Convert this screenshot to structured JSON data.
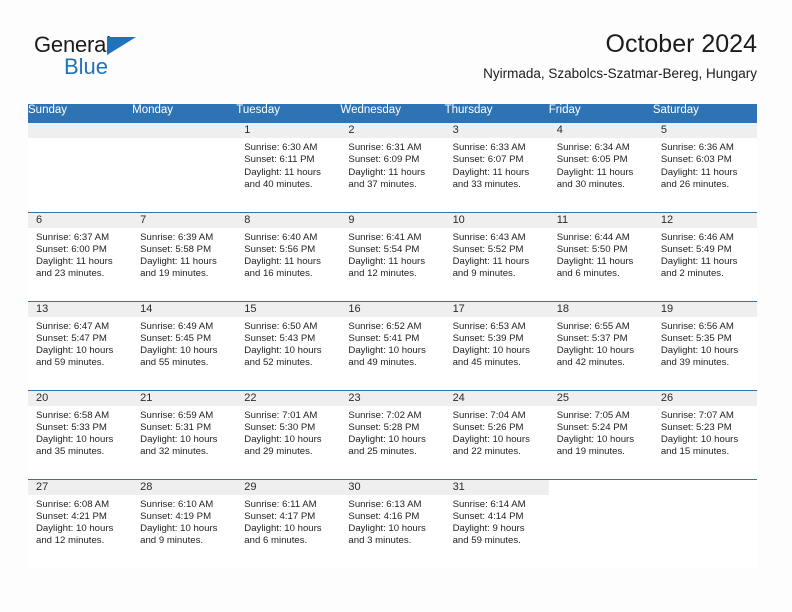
{
  "logo": {
    "word_one": "General",
    "word_two": "Blue",
    "triangle_color": "#1f72bb",
    "text_color": "#1b1b1b"
  },
  "header": {
    "title": "October 2024",
    "location": "Nyirmada, Szabolcs-Szatmar-Bereg, Hungary"
  },
  "theme": {
    "header_blue": "#2e74b5",
    "daynum_band": "#efefef",
    "page_bg": "#fdfdfd",
    "text": "#1f1f1f"
  },
  "calendar": {
    "weekday_headers": [
      "Sunday",
      "Monday",
      "Tuesday",
      "Wednesday",
      "Thursday",
      "Friday",
      "Saturday"
    ],
    "labels": {
      "sunrise": "Sunrise:",
      "sunset": "Sunset:",
      "daylight": "Daylight:"
    },
    "weeks": [
      [
        {
          "day": "",
          "sunrise": "",
          "sunset": "",
          "daylight_a": "",
          "daylight_b": ""
        },
        {
          "day": "",
          "sunrise": "",
          "sunset": "",
          "daylight_a": "",
          "daylight_b": ""
        },
        {
          "day": "1",
          "sunrise": "Sunrise: 6:30 AM",
          "sunset": "Sunset: 6:11 PM",
          "daylight_a": "Daylight: 11 hours",
          "daylight_b": "and 40 minutes."
        },
        {
          "day": "2",
          "sunrise": "Sunrise: 6:31 AM",
          "sunset": "Sunset: 6:09 PM",
          "daylight_a": "Daylight: 11 hours",
          "daylight_b": "and 37 minutes."
        },
        {
          "day": "3",
          "sunrise": "Sunrise: 6:33 AM",
          "sunset": "Sunset: 6:07 PM",
          "daylight_a": "Daylight: 11 hours",
          "daylight_b": "and 33 minutes."
        },
        {
          "day": "4",
          "sunrise": "Sunrise: 6:34 AM",
          "sunset": "Sunset: 6:05 PM",
          "daylight_a": "Daylight: 11 hours",
          "daylight_b": "and 30 minutes."
        },
        {
          "day": "5",
          "sunrise": "Sunrise: 6:36 AM",
          "sunset": "Sunset: 6:03 PM",
          "daylight_a": "Daylight: 11 hours",
          "daylight_b": "and 26 minutes."
        }
      ],
      [
        {
          "day": "6",
          "sunrise": "Sunrise: 6:37 AM",
          "sunset": "Sunset: 6:00 PM",
          "daylight_a": "Daylight: 11 hours",
          "daylight_b": "and 23 minutes."
        },
        {
          "day": "7",
          "sunrise": "Sunrise: 6:39 AM",
          "sunset": "Sunset: 5:58 PM",
          "daylight_a": "Daylight: 11 hours",
          "daylight_b": "and 19 minutes."
        },
        {
          "day": "8",
          "sunrise": "Sunrise: 6:40 AM",
          "sunset": "Sunset: 5:56 PM",
          "daylight_a": "Daylight: 11 hours",
          "daylight_b": "and 16 minutes."
        },
        {
          "day": "9",
          "sunrise": "Sunrise: 6:41 AM",
          "sunset": "Sunset: 5:54 PM",
          "daylight_a": "Daylight: 11 hours",
          "daylight_b": "and 12 minutes."
        },
        {
          "day": "10",
          "sunrise": "Sunrise: 6:43 AM",
          "sunset": "Sunset: 5:52 PM",
          "daylight_a": "Daylight: 11 hours",
          "daylight_b": "and 9 minutes."
        },
        {
          "day": "11",
          "sunrise": "Sunrise: 6:44 AM",
          "sunset": "Sunset: 5:50 PM",
          "daylight_a": "Daylight: 11 hours",
          "daylight_b": "and 6 minutes."
        },
        {
          "day": "12",
          "sunrise": "Sunrise: 6:46 AM",
          "sunset": "Sunset: 5:49 PM",
          "daylight_a": "Daylight: 11 hours",
          "daylight_b": "and 2 minutes."
        }
      ],
      [
        {
          "day": "13",
          "sunrise": "Sunrise: 6:47 AM",
          "sunset": "Sunset: 5:47 PM",
          "daylight_a": "Daylight: 10 hours",
          "daylight_b": "and 59 minutes."
        },
        {
          "day": "14",
          "sunrise": "Sunrise: 6:49 AM",
          "sunset": "Sunset: 5:45 PM",
          "daylight_a": "Daylight: 10 hours",
          "daylight_b": "and 55 minutes."
        },
        {
          "day": "15",
          "sunrise": "Sunrise: 6:50 AM",
          "sunset": "Sunset: 5:43 PM",
          "daylight_a": "Daylight: 10 hours",
          "daylight_b": "and 52 minutes."
        },
        {
          "day": "16",
          "sunrise": "Sunrise: 6:52 AM",
          "sunset": "Sunset: 5:41 PM",
          "daylight_a": "Daylight: 10 hours",
          "daylight_b": "and 49 minutes."
        },
        {
          "day": "17",
          "sunrise": "Sunrise: 6:53 AM",
          "sunset": "Sunset: 5:39 PM",
          "daylight_a": "Daylight: 10 hours",
          "daylight_b": "and 45 minutes."
        },
        {
          "day": "18",
          "sunrise": "Sunrise: 6:55 AM",
          "sunset": "Sunset: 5:37 PM",
          "daylight_a": "Daylight: 10 hours",
          "daylight_b": "and 42 minutes."
        },
        {
          "day": "19",
          "sunrise": "Sunrise: 6:56 AM",
          "sunset": "Sunset: 5:35 PM",
          "daylight_a": "Daylight: 10 hours",
          "daylight_b": "and 39 minutes."
        }
      ],
      [
        {
          "day": "20",
          "sunrise": "Sunrise: 6:58 AM",
          "sunset": "Sunset: 5:33 PM",
          "daylight_a": "Daylight: 10 hours",
          "daylight_b": "and 35 minutes."
        },
        {
          "day": "21",
          "sunrise": "Sunrise: 6:59 AM",
          "sunset": "Sunset: 5:31 PM",
          "daylight_a": "Daylight: 10 hours",
          "daylight_b": "and 32 minutes."
        },
        {
          "day": "22",
          "sunrise": "Sunrise: 7:01 AM",
          "sunset": "Sunset: 5:30 PM",
          "daylight_a": "Daylight: 10 hours",
          "daylight_b": "and 29 minutes."
        },
        {
          "day": "23",
          "sunrise": "Sunrise: 7:02 AM",
          "sunset": "Sunset: 5:28 PM",
          "daylight_a": "Daylight: 10 hours",
          "daylight_b": "and 25 minutes."
        },
        {
          "day": "24",
          "sunrise": "Sunrise: 7:04 AM",
          "sunset": "Sunset: 5:26 PM",
          "daylight_a": "Daylight: 10 hours",
          "daylight_b": "and 22 minutes."
        },
        {
          "day": "25",
          "sunrise": "Sunrise: 7:05 AM",
          "sunset": "Sunset: 5:24 PM",
          "daylight_a": "Daylight: 10 hours",
          "daylight_b": "and 19 minutes."
        },
        {
          "day": "26",
          "sunrise": "Sunrise: 7:07 AM",
          "sunset": "Sunset: 5:23 PM",
          "daylight_a": "Daylight: 10 hours",
          "daylight_b": "and 15 minutes."
        }
      ],
      [
        {
          "day": "27",
          "sunrise": "Sunrise: 6:08 AM",
          "sunset": "Sunset: 4:21 PM",
          "daylight_a": "Daylight: 10 hours",
          "daylight_b": "and 12 minutes."
        },
        {
          "day": "28",
          "sunrise": "Sunrise: 6:10 AM",
          "sunset": "Sunset: 4:19 PM",
          "daylight_a": "Daylight: 10 hours",
          "daylight_b": "and 9 minutes."
        },
        {
          "day": "29",
          "sunrise": "Sunrise: 6:11 AM",
          "sunset": "Sunset: 4:17 PM",
          "daylight_a": "Daylight: 10 hours",
          "daylight_b": "and 6 minutes."
        },
        {
          "day": "30",
          "sunrise": "Sunrise: 6:13 AM",
          "sunset": "Sunset: 4:16 PM",
          "daylight_a": "Daylight: 10 hours",
          "daylight_b": "and 3 minutes."
        },
        {
          "day": "31",
          "sunrise": "Sunrise: 6:14 AM",
          "sunset": "Sunset: 4:14 PM",
          "daylight_a": "Daylight: 9 hours",
          "daylight_b": "and 59 minutes."
        },
        {
          "day": "",
          "sunrise": "",
          "sunset": "",
          "daylight_a": "",
          "daylight_b": ""
        },
        {
          "day": "",
          "sunrise": "",
          "sunset": "",
          "daylight_a": "",
          "daylight_b": ""
        }
      ]
    ]
  }
}
